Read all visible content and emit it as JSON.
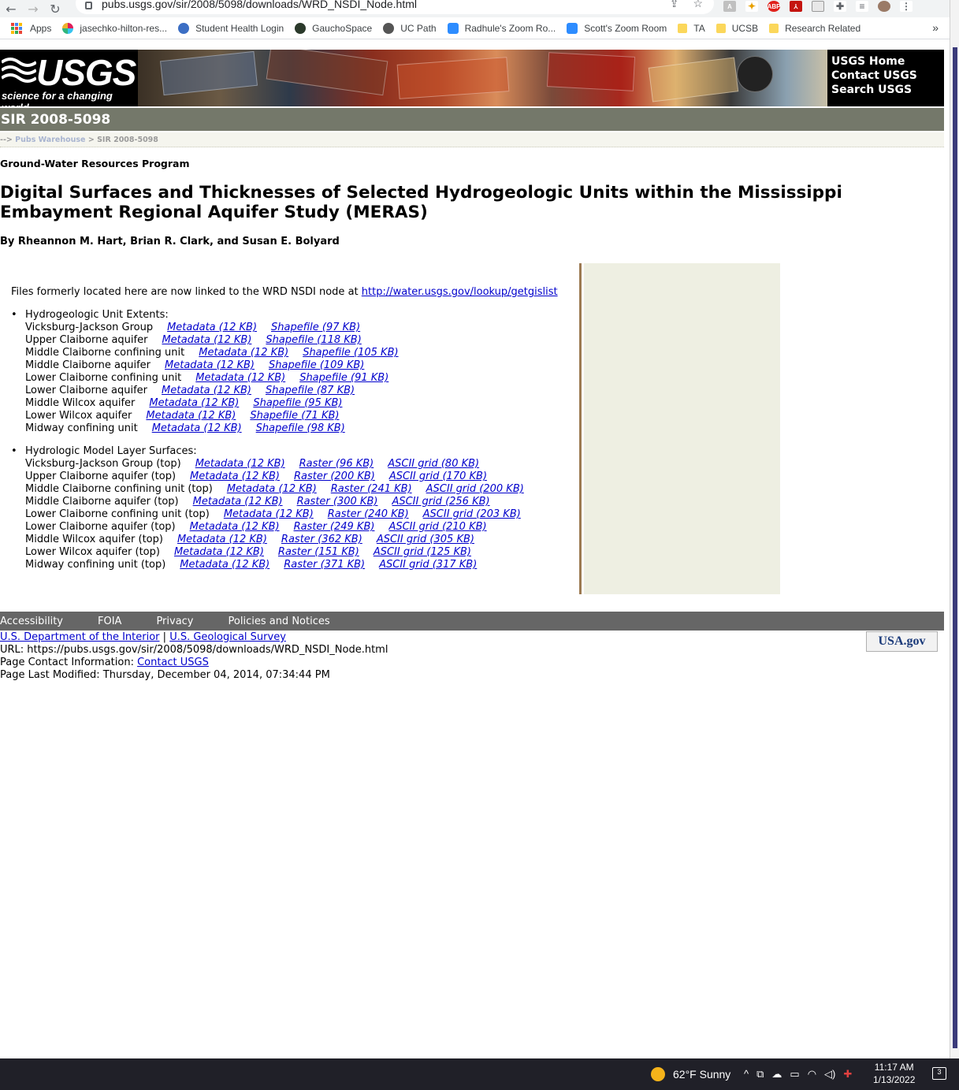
{
  "browser": {
    "url": "pubs.usgs.gov/sir/2008/5098/downloads/WRD_NSDI_Node.html",
    "bookmarks": [
      {
        "label": "Apps"
      },
      {
        "label": "jasechko-hilton-res..."
      },
      {
        "label": "Student Health Login"
      },
      {
        "label": "GauchoSpace"
      },
      {
        "label": "UC Path"
      },
      {
        "label": "Radhule's Zoom Ro..."
      },
      {
        "label": "Scott's Zoom Room"
      },
      {
        "label": "TA"
      },
      {
        "label": "UCSB"
      },
      {
        "label": "Research Related"
      }
    ],
    "more": "»"
  },
  "header": {
    "logo_text": "USGS",
    "tagline": "science for a changing world",
    "links": [
      "USGS Home",
      "Contact USGS",
      "Search USGS"
    ],
    "series": "SIR 2008-5098",
    "breadcrumb_prefix": "-->",
    "breadcrumb_link": "Pubs Warehouse",
    "breadcrumb_current": "> SIR 2008-5098"
  },
  "page": {
    "program": "Ground-Water Resources Program",
    "title": "Digital Surfaces and Thicknesses of Selected Hydrogeologic Units within the Mississippi Embayment Regional Aquifer Study (MERAS)",
    "authors": "By Rheannon M. Hart, Brian R. Clark, and Susan E. Bolyard",
    "notice_text": "Files formerly located here are now linked to the WRD NSDI node at ",
    "notice_link": "http://water.usgs.gov/lookup/getgislist"
  },
  "extents": {
    "heading": "Hydrogeologic Unit Extents:",
    "rows": [
      {
        "name": "Vicksburg-Jackson Group",
        "metadata": "Metadata (12 KB)",
        "shapefile": "Shapefile (97 KB)"
      },
      {
        "name": "Upper Claiborne aquifer",
        "metadata": "Metadata (12 KB)",
        "shapefile": "Shapefile (118 KB)"
      },
      {
        "name": "Middle Claiborne confining unit",
        "metadata": "Metadata (12 KB)",
        "shapefile": "Shapefile (105 KB)"
      },
      {
        "name": "Middle Claiborne aquifer",
        "metadata": "Metadata (12 KB)",
        "shapefile": "Shapefile (109 KB)"
      },
      {
        "name": "Lower Claiborne confining unit",
        "metadata": "Metadata (12 KB)",
        "shapefile": "Shapefile (91 KB)"
      },
      {
        "name": "Lower Claiborne aquifer",
        "metadata": "Metadata (12 KB)",
        "shapefile": "Shapefile (87 KB)"
      },
      {
        "name": "Middle Wilcox aquifer",
        "metadata": "Metadata (12 KB)",
        "shapefile": "Shapefile (95 KB)"
      },
      {
        "name": "Lower Wilcox aquifer",
        "metadata": "Metadata (12 KB)",
        "shapefile": "Shapefile (71 KB)"
      },
      {
        "name": "Midway confining unit",
        "metadata": "Metadata (12 KB)",
        "shapefile": "Shapefile (98 KB)"
      }
    ]
  },
  "surfaces": {
    "heading": "Hydrologic Model Layer Surfaces:",
    "rows": [
      {
        "name": "Vicksburg-Jackson Group (top)",
        "metadata": "Metadata (12 KB)",
        "raster": "Raster (96 KB)",
        "ascii": "ASCII grid (80 KB)"
      },
      {
        "name": "Upper Claiborne aquifer (top)",
        "metadata": "Metadata (12 KB)",
        "raster": "Raster (200 KB)",
        "ascii": "ASCII grid (170 KB)"
      },
      {
        "name": "Middle Claiborne confining unit (top)",
        "metadata": "Metadata (12 KB)",
        "raster": "Raster (241 KB)",
        "ascii": "ASCII grid (200 KB)"
      },
      {
        "name": "Middle Claiborne aquifer (top)",
        "metadata": "Metadata (12 KB)",
        "raster": "Raster (300 KB)",
        "ascii": "ASCII grid (256 KB)"
      },
      {
        "name": "Lower Claiborne confining unit (top)",
        "metadata": "Metadata (12 KB)",
        "raster": "Raster (240 KB)",
        "ascii": "ASCII grid (203 KB)"
      },
      {
        "name": "Lower Claiborne aquifer (top)",
        "metadata": "Metadata (12 KB)",
        "raster": "Raster (249 KB)",
        "ascii": "ASCII grid (210 KB)"
      },
      {
        "name": "Middle Wilcox aquifer (top)",
        "metadata": "Metadata (12 KB)",
        "raster": "Raster (362 KB)",
        "ascii": "ASCII grid (305 KB)"
      },
      {
        "name": "Lower Wilcox aquifer (top)",
        "metadata": "Metadata (12 KB)",
        "raster": "Raster (151 KB)",
        "ascii": "ASCII grid (125 KB)"
      },
      {
        "name": "Midway confining unit (top)",
        "metadata": "Metadata (12 KB)",
        "raster": "Raster (371 KB)",
        "ascii": "ASCII grid (317 KB)"
      }
    ]
  },
  "footer": {
    "links": [
      "Accessibility",
      "FOIA",
      "Privacy",
      "Policies and Notices"
    ],
    "doi": "U.S. Department of the Interior",
    "separator": "|",
    "usgs": "U.S. Geological Survey",
    "url_line": "URL: https://pubs.usgs.gov/sir/2008/5098/downloads/WRD_NSDI_Node.html",
    "contact_prefix": "Page Contact Information: ",
    "contact_link": "Contact USGS",
    "modified": "Page Last Modified: Thursday, December 04, 2014, 07:34:44 PM",
    "usagov": "USA.gov"
  },
  "taskbar": {
    "weather": "62°F  Sunny",
    "time": "11:17 AM",
    "date": "1/13/2022",
    "notifications": "3"
  },
  "colors": {
    "link": "#0000cc",
    "sir_bar": "#74786a",
    "side_panel": "#eeefe2",
    "divider": "#9c7a52",
    "footer_bar": "#666666"
  }
}
